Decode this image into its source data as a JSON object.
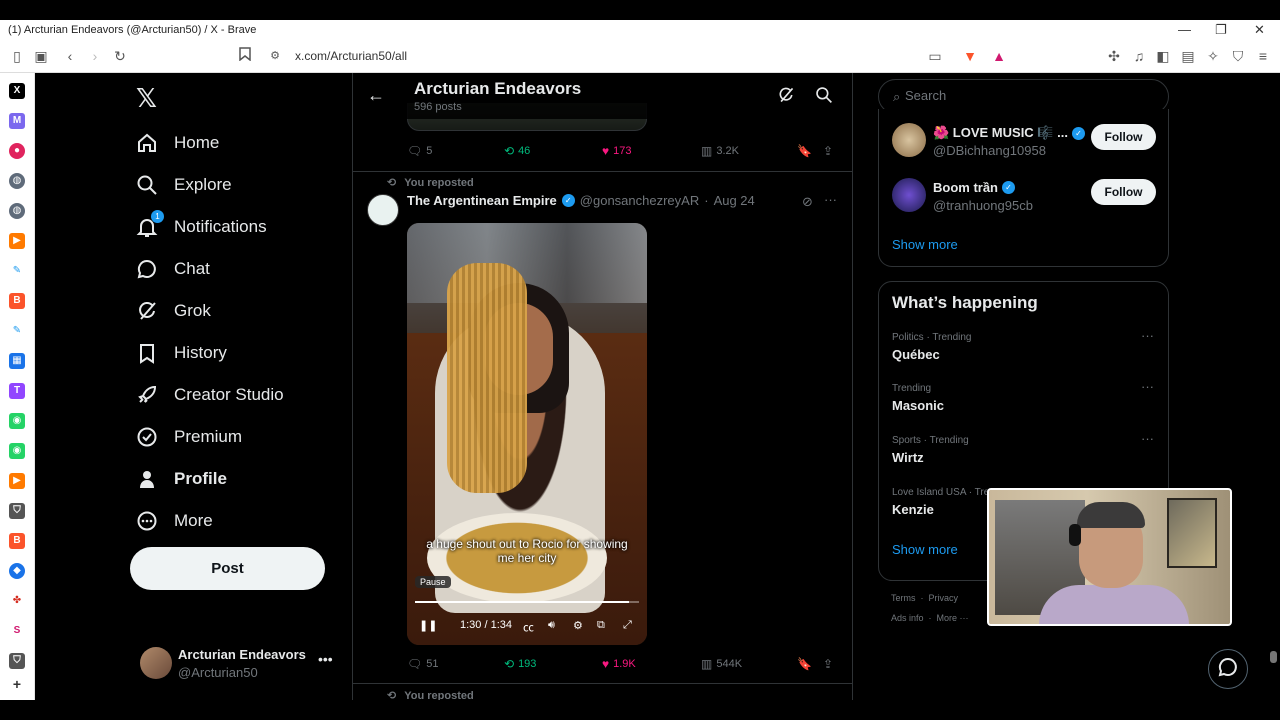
{
  "browser": {
    "window_title": "(1) Arcturian Endeavors (@Arcturian50) / X - Brave",
    "url": "x.com/Arcturian50/all",
    "minimize": "—",
    "maximize": "❐",
    "close": "✕"
  },
  "nav": {
    "items": [
      {
        "label": "Home",
        "icon": "home-icon"
      },
      {
        "label": "Explore",
        "icon": "search-icon"
      },
      {
        "label": "Notifications",
        "icon": "bell-icon",
        "badge": "1"
      },
      {
        "label": "Chat",
        "icon": "chat-icon"
      },
      {
        "label": "Grok",
        "icon": "grok-icon"
      },
      {
        "label": "History",
        "icon": "bookmark-icon"
      },
      {
        "label": "Creator Studio",
        "icon": "rocket-icon"
      },
      {
        "label": "Premium",
        "icon": "verified-icon"
      },
      {
        "label": "Profile",
        "icon": "person-icon"
      },
      {
        "label": "More",
        "icon": "more-circle-icon"
      }
    ],
    "post_label": "Post",
    "account": {
      "name": "Arcturian Endeavors",
      "handle": "@Arcturian50"
    }
  },
  "header": {
    "title": "Arcturian Endeavors",
    "subtitle": "596 posts"
  },
  "prev_tweet": {
    "replies": "5",
    "reposts": "46",
    "likes": "173",
    "views": "3.2K"
  },
  "tweet": {
    "repost_note": "You reposted",
    "author": "The Argentinean Empire",
    "handle": "@gonsanchezreyAR",
    "date": "Aug 24",
    "video": {
      "caption": "a huge shout out to Rocio for showing me her city",
      "pause_tip": "Pause",
      "time": "1:30 / 1:34",
      "progress": 0.9574
    },
    "replies": "51",
    "reposts": "193",
    "likes": "1.9K",
    "views": "544K"
  },
  "next_repost_note": "You reposted",
  "right": {
    "search_placeholder": "Search",
    "who_to_follow": [
      {
        "name": "🌺 LOVE MUSIC 🎼 ...",
        "handle": "@DBichhang10958",
        "follow": "Follow"
      },
      {
        "name": "Boom trần",
        "handle": "@tranhuong95cb",
        "follow": "Follow"
      }
    ],
    "show_more": "Show more",
    "happening_title": "What’s happening",
    "trends": [
      {
        "context": "Politics · Trending",
        "title": "Québec"
      },
      {
        "context": "Trending",
        "title": "Masonic"
      },
      {
        "context": "Sports · Trending",
        "title": "Wirtz"
      },
      {
        "context": "Love Island USA · Tre",
        "title": "Kenzie"
      }
    ],
    "happening_show_more": "Show more",
    "footer": {
      "terms": "Terms",
      "privacy": "Privacy",
      "ads": "Ads info",
      "more": "More ···"
    }
  },
  "colors": {
    "accent": "#1d9bf0",
    "like": "#f91880",
    "repost": "#00ba7c",
    "bg": "#000000"
  }
}
